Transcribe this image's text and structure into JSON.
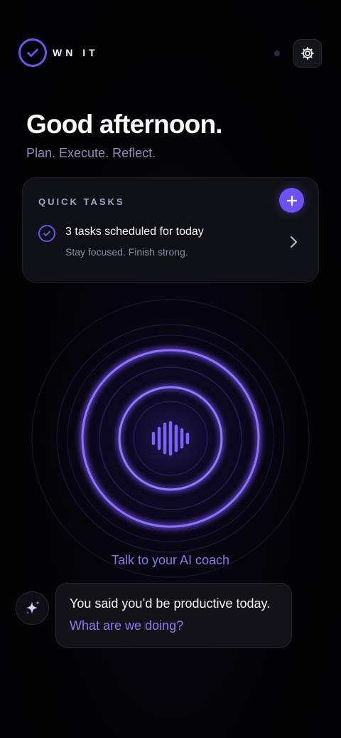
{
  "header": {
    "logo_text": "WN IT",
    "logo_icon": "check-circle-icon",
    "settings_icon": "gear-icon"
  },
  "greeting": {
    "title": "Good afternoon.",
    "tagline": "Plan. Execute. Reflect."
  },
  "quick_tasks": {
    "title": "QUICK TASKS",
    "add_icon": "plus-icon",
    "task_title": "3 tasks scheduled for today",
    "task_subtitle": "Stay focused. Finish strong.",
    "chevron_icon": "chevron-right-icon"
  },
  "voice": {
    "icon": "sound-wave-icon",
    "label": "Talk to your AI coach"
  },
  "chat": {
    "avatar_icon": "sparkle-icon",
    "line1": "You said you’d be productive today.",
    "line2": "What are we doing?"
  },
  "colors": {
    "accent": "#6b52f2",
    "accent_light": "#8e7cf0",
    "background": "#030305",
    "card": "#0f1015",
    "muted_text": "#8f8db8"
  }
}
